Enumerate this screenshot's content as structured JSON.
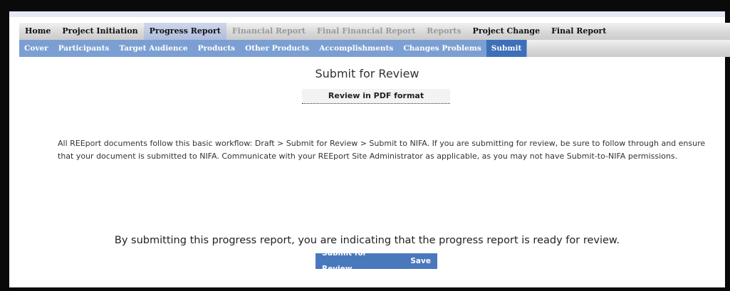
{
  "nav_primary": [
    {
      "label": "Home",
      "state": "normal"
    },
    {
      "label": "Project Initiation",
      "state": "normal"
    },
    {
      "label": "Progress Report",
      "state": "active"
    },
    {
      "label": "Financial Report",
      "state": "disabled"
    },
    {
      "label": "Final Financial Report",
      "state": "disabled"
    },
    {
      "label": "Reports",
      "state": "disabled"
    },
    {
      "label": "Project Change",
      "state": "normal"
    },
    {
      "label": "Final Report",
      "state": "normal"
    }
  ],
  "nav_secondary": [
    {
      "label": "Cover",
      "state": "normal"
    },
    {
      "label": "Participants",
      "state": "normal"
    },
    {
      "label": "Target Audience",
      "state": "normal"
    },
    {
      "label": "Products",
      "state": "normal"
    },
    {
      "label": "Other Products",
      "state": "normal"
    },
    {
      "label": "Accomplishments",
      "state": "normal"
    },
    {
      "label": "Changes Problems",
      "state": "normal"
    },
    {
      "label": "Submit",
      "state": "active"
    }
  ],
  "page": {
    "title": "Submit for Review",
    "pdf_link": "Review in PDF format",
    "workflow_text": "All REEport documents follow this basic workflow:  Draft > Submit for Review > Submit to NIFA.  If you are submitting for review, be sure to follow through and ensure that your document is submitted to NIFA.  Communicate with your REEport Site Administrator as applicable, as you may not have Submit-to-NIFA permissions.",
    "statement": "By submitting this progress report, you are indicating that the progress report is ready for review.",
    "submit_label": "Submit for Review",
    "save_label": "Save"
  },
  "colors": {
    "nav_blue": "#7b9fd2",
    "nav_active": "#3e6fb9",
    "button_blue": "#4a78bd"
  }
}
